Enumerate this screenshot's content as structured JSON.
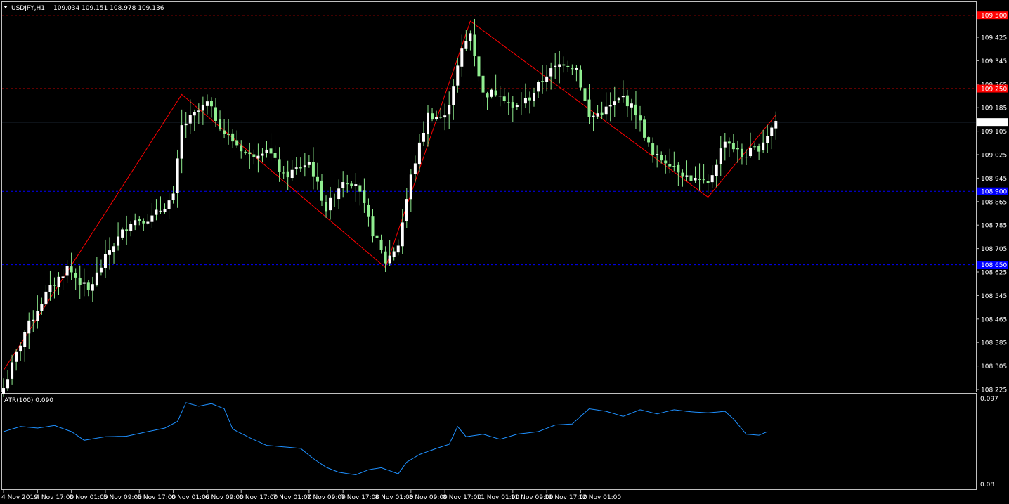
{
  "window": {
    "title": "USDJPY,H1",
    "ohlc": "109.034 109.151 108.978 109.136"
  },
  "indicator": {
    "label": "ATR(100) 0.090",
    "axis_top": "0.097",
    "axis_bottom": "0.08"
  },
  "colors": {
    "background": "#000000",
    "bull": "#ffffff",
    "bear": "#90ee90",
    "zigzag": "#ff0000",
    "atr": "#1e90ff",
    "price_line": "#6a8dc4",
    "resistance": "#ff0000",
    "support": "#0000ff",
    "frame": "#c0c0c0"
  },
  "chart_data": {
    "type": "candlestick",
    "symbol": "USDJPY",
    "timeframe": "H1",
    "ylim": [
      108.22,
      109.52
    ],
    "y_ticks": [
      "109.425",
      "109.345",
      "109.265",
      "109.185",
      "109.105",
      "109.025",
      "108.945",
      "108.865",
      "108.785",
      "108.705",
      "108.625",
      "108.545",
      "108.465",
      "108.385",
      "108.305",
      "108.225"
    ],
    "x_ticks": [
      "4 Nov 2019",
      "4 Nov 17:00",
      "5 Nov 01:00",
      "5 Nov 09:00",
      "5 Nov 17:00",
      "6 Nov 01:00",
      "6 Nov 09:00",
      "6 Nov 17:00",
      "7 Nov 01:00",
      "7 Nov 09:00",
      "7 Nov 17:00",
      "8 Nov 01:00",
      "8 Nov 09:00",
      "8 Nov 17:00",
      "11 Nov 01:00",
      "11 Nov 09:00",
      "11 Nov 17:00",
      "12 Nov 01:00"
    ],
    "current_price": "109.136",
    "levels": [
      {
        "value": 109.5,
        "label": "109.500",
        "kind": "resistance"
      },
      {
        "value": 109.25,
        "label": "109.250",
        "kind": "resistance"
      },
      {
        "value": 108.9,
        "label": "108.900",
        "kind": "support"
      },
      {
        "value": 108.65,
        "label": "108.650",
        "kind": "support"
      }
    ],
    "zigzag": [
      [
        0,
        108.29
      ],
      [
        42,
        109.23
      ],
      [
        90,
        108.64
      ],
      [
        110,
        109.48
      ],
      [
        166,
        108.88
      ],
      [
        182,
        109.16
      ]
    ],
    "anchors": [
      [
        0,
        108.23
      ],
      [
        5,
        108.42
      ],
      [
        10,
        108.55
      ],
      [
        15,
        108.64
      ],
      [
        20,
        108.56
      ],
      [
        25,
        108.7
      ],
      [
        30,
        108.8
      ],
      [
        35,
        108.81
      ],
      [
        40,
        108.88
      ],
      [
        42,
        109.12
      ],
      [
        45,
        109.16
      ],
      [
        48,
        109.2
      ],
      [
        52,
        109.1
      ],
      [
        58,
        109.02
      ],
      [
        62,
        109.05
      ],
      [
        66,
        108.95
      ],
      [
        72,
        109.0
      ],
      [
        76,
        108.84
      ],
      [
        80,
        108.94
      ],
      [
        83,
        108.93
      ],
      [
        87,
        108.76
      ],
      [
        90,
        108.66
      ],
      [
        93,
        108.72
      ],
      [
        96,
        108.95
      ],
      [
        100,
        109.16
      ],
      [
        104,
        109.15
      ],
      [
        108,
        109.38
      ],
      [
        110,
        109.44
      ],
      [
        113,
        109.23
      ],
      [
        117,
        109.24
      ],
      [
        120,
        109.18
      ],
      [
        124,
        109.22
      ],
      [
        128,
        109.3
      ],
      [
        132,
        109.34
      ],
      [
        135,
        109.32
      ],
      [
        138,
        109.15
      ],
      [
        142,
        109.18
      ],
      [
        146,
        109.22
      ],
      [
        149,
        109.17
      ],
      [
        153,
        109.02
      ],
      [
        157,
        109.0
      ],
      [
        161,
        108.95
      ],
      [
        166,
        108.92
      ],
      [
        170,
        109.08
      ],
      [
        174,
        109.02
      ],
      [
        178,
        109.05
      ],
      [
        182,
        109.14
      ]
    ],
    "atr": {
      "name": "ATR(100)",
      "ylim": [
        0.08,
        0.097
      ],
      "anchors": [
        [
          0,
          0.0905
        ],
        [
          4,
          0.0915
        ],
        [
          8,
          0.0912
        ],
        [
          12,
          0.0917
        ],
        [
          16,
          0.0905
        ],
        [
          19,
          0.0888
        ],
        [
          24,
          0.0895
        ],
        [
          29,
          0.0896
        ],
        [
          34,
          0.0905
        ],
        [
          38,
          0.0912
        ],
        [
          41,
          0.0925
        ],
        [
          43,
          0.0962
        ],
        [
          46,
          0.0955
        ],
        [
          49,
          0.096
        ],
        [
          52,
          0.095
        ],
        [
          54,
          0.091
        ],
        [
          58,
          0.0893
        ],
        [
          62,
          0.0878
        ],
        [
          66,
          0.0875
        ],
        [
          70,
          0.0872
        ],
        [
          73,
          0.0852
        ],
        [
          76,
          0.0835
        ],
        [
          79,
          0.0825
        ],
        [
          83,
          0.082
        ],
        [
          86,
          0.083
        ],
        [
          89,
          0.0834
        ],
        [
          93,
          0.0822
        ],
        [
          95,
          0.0845
        ],
        [
          98,
          0.086
        ],
        [
          102,
          0.0872
        ],
        [
          105,
          0.088
        ],
        [
          107,
          0.0915
        ],
        [
          109,
          0.0895
        ],
        [
          113,
          0.09
        ],
        [
          117,
          0.089
        ],
        [
          121,
          0.09
        ],
        [
          126,
          0.0905
        ],
        [
          130,
          0.0918
        ],
        [
          134,
          0.092
        ],
        [
          138,
          0.095
        ],
        [
          142,
          0.0945
        ],
        [
          146,
          0.0935
        ],
        [
          150,
          0.0948
        ],
        [
          154,
          0.094
        ],
        [
          158,
          0.0948
        ],
        [
          162,
          0.0944
        ],
        [
          166,
          0.0942
        ],
        [
          170,
          0.0945
        ],
        [
          172,
          0.093
        ],
        [
          175,
          0.09
        ],
        [
          178,
          0.0898
        ],
        [
          180,
          0.0905
        ]
      ]
    }
  }
}
